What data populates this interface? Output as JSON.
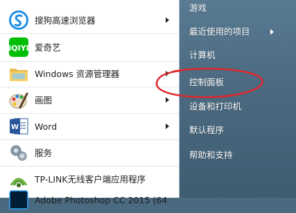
{
  "programs": [
    {
      "label": "搜狗高速浏览器",
      "icon": "sogou-browser-icon",
      "has_submenu": true
    },
    {
      "label": "爱奇艺",
      "icon": "iqiyi-icon",
      "has_submenu": false
    },
    {
      "label": "Windows 资源管理器",
      "icon": "windows-explorer-icon",
      "has_submenu": true
    },
    {
      "label": "画图",
      "icon": "paint-icon",
      "has_submenu": true
    },
    {
      "label": "Word",
      "icon": "word-icon",
      "has_submenu": true
    },
    {
      "label": "服务",
      "icon": "services-icon",
      "has_submenu": false
    },
    {
      "label": "TP-LINK无线客户端应用程序",
      "icon": "tplink-wireless-icon",
      "has_submenu": false
    },
    {
      "label": "Adobe Photoshop CC 2015 (64",
      "icon": "photoshop-icon",
      "has_submenu": false
    }
  ],
  "right_items": [
    {
      "label": "游戏",
      "has_submenu": false
    },
    {
      "label": "最近使用的项目",
      "has_submenu": true
    },
    {
      "label": "计算机",
      "has_submenu": false
    },
    {
      "label": "控制面板",
      "has_submenu": false
    },
    {
      "label": "设备和打印机",
      "has_submenu": false
    },
    {
      "label": "默认程序",
      "has_submenu": false
    },
    {
      "label": "帮助和支持",
      "has_submenu": false
    }
  ],
  "colors": {
    "left_bg": "#ffffff",
    "right_bg": "#4b6a80",
    "annotation": "#e0262a"
  }
}
